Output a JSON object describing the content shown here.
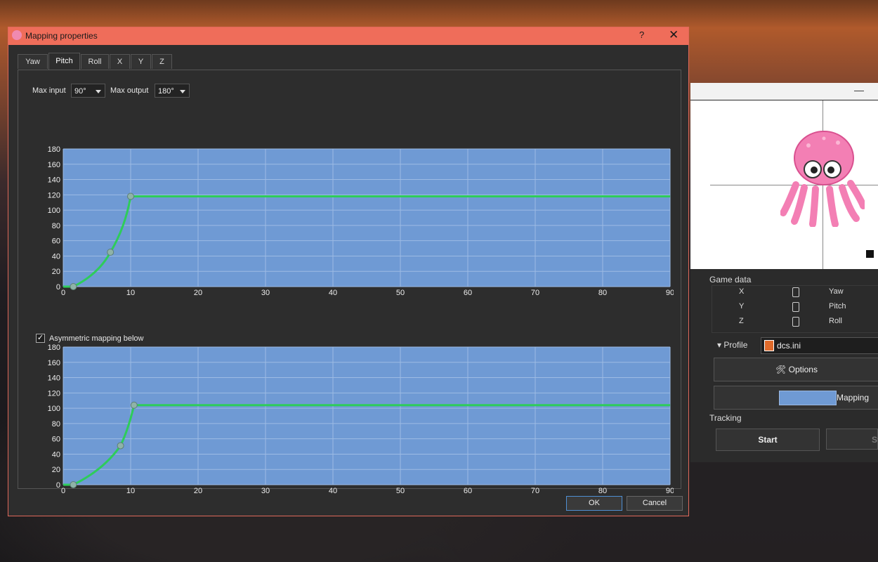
{
  "app": {
    "minimize_glyph": "—",
    "game_data": {
      "label": "Game data",
      "rows": [
        {
          "axis": "X",
          "value": "0",
          "name": "Yaw"
        },
        {
          "axis": "Y",
          "value": "0",
          "name": "Pitch"
        },
        {
          "axis": "Z",
          "value": "0",
          "name": "Roll"
        }
      ]
    },
    "profile": {
      "label": "Profile",
      "value": "dcs.ini"
    },
    "options_label": "Options",
    "mapping_label": "Mapping",
    "tracking_label": "Tracking",
    "start_label": "Start",
    "stop_label": "St"
  },
  "dialog": {
    "title": "Mapping properties",
    "help_glyph": "?",
    "close_glyph": "✕",
    "tabs": [
      {
        "label": "Yaw",
        "active": false
      },
      {
        "label": "Pitch",
        "active": true
      },
      {
        "label": "Roll",
        "active": false
      },
      {
        "label": "X",
        "active": false
      },
      {
        "label": "Y",
        "active": false
      },
      {
        "label": "Z",
        "active": false
      }
    ],
    "max_input_label": "Max input",
    "max_input_value": "90°",
    "max_output_label": "Max output",
    "max_output_value": "180°",
    "asymmetric_label": "Asymmetric mapping below",
    "asymmetric_checked": true,
    "ok_label": "OK",
    "cancel_label": "Cancel"
  },
  "chart_data": [
    {
      "type": "line",
      "title": "",
      "xlim": [
        0,
        90
      ],
      "ylim": [
        0,
        180
      ],
      "xticks": [
        0,
        10,
        20,
        30,
        40,
        50,
        60,
        70,
        80,
        90
      ],
      "yticks": [
        0,
        20,
        40,
        60,
        80,
        100,
        120,
        140,
        160,
        180
      ],
      "grid": true,
      "background": "#6f9ad4",
      "line_color": "#2ecc5a",
      "control_points": [
        {
          "x": 1.5,
          "y": 0
        },
        {
          "x": 7,
          "y": 45
        },
        {
          "x": 10,
          "y": 118
        }
      ],
      "flat_value": 118
    },
    {
      "type": "line",
      "title": "",
      "xlim": [
        0,
        90
      ],
      "ylim": [
        0,
        180
      ],
      "xticks": [
        0,
        10,
        20,
        30,
        40,
        50,
        60,
        70,
        80,
        90
      ],
      "yticks": [
        0,
        20,
        40,
        60,
        80,
        100,
        120,
        140,
        160,
        180
      ],
      "grid": true,
      "background": "#6f9ad4",
      "line_color": "#2ecc5a",
      "control_points": [
        {
          "x": 1.5,
          "y": 0
        },
        {
          "x": 8.5,
          "y": 51
        },
        {
          "x": 10.5,
          "y": 104
        }
      ],
      "flat_value": 104
    }
  ]
}
